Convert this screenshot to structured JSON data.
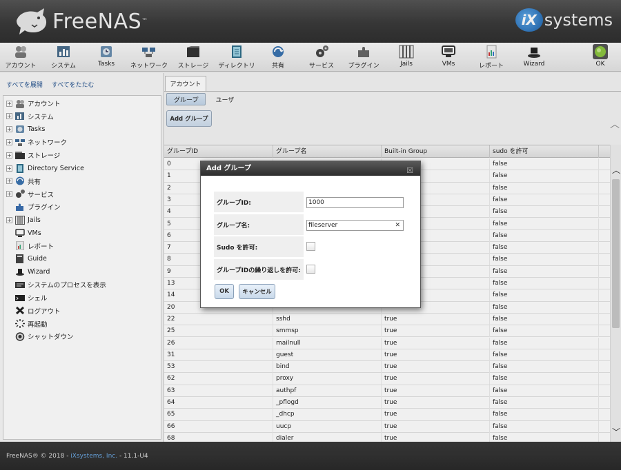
{
  "header": {
    "logo_text": "FreeNAS",
    "brand_right": "systems",
    "brand_badge": "iX"
  },
  "toolbar": [
    {
      "id": "account",
      "label": "アカウント",
      "icon": "users-icon"
    },
    {
      "id": "system",
      "label": "システム",
      "icon": "system-icon"
    },
    {
      "id": "tasks",
      "label": "Tasks",
      "icon": "tasks-icon"
    },
    {
      "id": "network",
      "label": "ネットワーク",
      "icon": "network-icon"
    },
    {
      "id": "storage",
      "label": "ストレージ",
      "icon": "storage-icon"
    },
    {
      "id": "directory",
      "label": "ディレクトリ",
      "icon": "directory-icon"
    },
    {
      "id": "sharing",
      "label": "共有",
      "icon": "sharing-icon"
    },
    {
      "id": "services",
      "label": "サービス",
      "icon": "services-icon"
    },
    {
      "id": "plugins",
      "label": "プラグイン",
      "icon": "plugins-icon"
    },
    {
      "id": "jails",
      "label": "Jails",
      "icon": "jails-icon"
    },
    {
      "id": "vms",
      "label": "VMs",
      "icon": "vms-icon"
    },
    {
      "id": "reports",
      "label": "レポート",
      "icon": "reports-icon"
    },
    {
      "id": "wizard",
      "label": "Wizard",
      "icon": "wizard-icon"
    },
    {
      "id": "ok",
      "label": "OK",
      "icon": "status-ok-icon"
    }
  ],
  "left": {
    "expand_all": "すべてを展開",
    "collapse_all": "すべてをたたむ",
    "tree": [
      {
        "label": "アカウント",
        "expandable": true,
        "icon": "users-icon"
      },
      {
        "label": "システム",
        "expandable": true,
        "icon": "system-icon"
      },
      {
        "label": "Tasks",
        "expandable": true,
        "icon": "tasks-icon"
      },
      {
        "label": "ネットワーク",
        "expandable": true,
        "icon": "network-icon"
      },
      {
        "label": "ストレージ",
        "expandable": true,
        "icon": "storage-icon"
      },
      {
        "label": "Directory Service",
        "expandable": true,
        "icon": "directory-icon"
      },
      {
        "label": "共有",
        "expandable": true,
        "icon": "sharing-icon"
      },
      {
        "label": "サービス",
        "expandable": true,
        "icon": "services-icon"
      },
      {
        "label": "プラグイン",
        "expandable": false,
        "icon": "plugins-icon"
      },
      {
        "label": "Jails",
        "expandable": true,
        "icon": "jails-icon"
      },
      {
        "label": "VMs",
        "expandable": false,
        "icon": "vms-icon"
      },
      {
        "label": "レポート",
        "expandable": false,
        "icon": "reports-icon"
      },
      {
        "label": "Guide",
        "expandable": false,
        "icon": "guide-icon"
      },
      {
        "label": "Wizard",
        "expandable": false,
        "icon": "wizard-icon"
      },
      {
        "label": "システムのプロセスを表示",
        "expandable": false,
        "icon": "process-icon"
      },
      {
        "label": "シェル",
        "expandable": false,
        "icon": "shell-icon"
      },
      {
        "label": "ログアウト",
        "expandable": false,
        "icon": "logout-icon"
      },
      {
        "label": "再起動",
        "expandable": false,
        "icon": "reboot-icon"
      },
      {
        "label": "シャットダウン",
        "expandable": false,
        "icon": "shutdown-icon"
      }
    ]
  },
  "main": {
    "tab": "アカウント",
    "subtabs": [
      "グループ",
      "ユーザ"
    ],
    "add_button": "Add グループ",
    "columns": [
      "グループID",
      "グループ名",
      "Built-in Group",
      "sudo を許可"
    ],
    "rows": [
      [
        "0",
        "",
        "",
        "false"
      ],
      [
        "1",
        "",
        "",
        "false"
      ],
      [
        "2",
        "",
        "",
        "false"
      ],
      [
        "3",
        "",
        "",
        "false"
      ],
      [
        "4",
        "",
        "",
        "false"
      ],
      [
        "5",
        "",
        "",
        "false"
      ],
      [
        "6",
        "",
        "",
        "false"
      ],
      [
        "7",
        "",
        "",
        "false"
      ],
      [
        "8",
        "",
        "",
        "false"
      ],
      [
        "9",
        "",
        "",
        "false"
      ],
      [
        "13",
        "",
        "",
        "false"
      ],
      [
        "14",
        "",
        "",
        "false"
      ],
      [
        "20",
        "",
        "",
        "false"
      ],
      [
        "22",
        "sshd",
        "true",
        "false"
      ],
      [
        "25",
        "smmsp",
        "true",
        "false"
      ],
      [
        "26",
        "mailnull",
        "true",
        "false"
      ],
      [
        "31",
        "guest",
        "true",
        "false"
      ],
      [
        "53",
        "bind",
        "true",
        "false"
      ],
      [
        "62",
        "proxy",
        "true",
        "false"
      ],
      [
        "63",
        "authpf",
        "true",
        "false"
      ],
      [
        "64",
        "_pflogd",
        "true",
        "false"
      ],
      [
        "65",
        "_dhcp",
        "true",
        "false"
      ],
      [
        "66",
        "uucp",
        "true",
        "false"
      ],
      [
        "68",
        "dialer",
        "true",
        "false"
      ]
    ]
  },
  "dialog": {
    "title": "Add グループ",
    "close_glyph": "☒",
    "fields": {
      "group_id_label": "グループID:",
      "group_id_value": "1000",
      "group_name_label": "グループ名:",
      "group_name_value": "fileserver",
      "clear_glyph": "✕",
      "sudo_label": "Sudo を許可:",
      "sudo_checked": false,
      "dup_label": "グループIDの繰り返しを許可:",
      "dup_checked": false
    },
    "ok_button": "OK",
    "cancel_button": "キャンセル"
  },
  "footer": {
    "prefix": "FreeNAS® © 2018 - ",
    "link": "iXsystems, Inc.",
    "suffix": " - 11.1-U4"
  },
  "colors": {
    "accent": "#1e4e8c",
    "header_dark": "#2f2f2f",
    "footer_link": "#6aa6e0"
  }
}
